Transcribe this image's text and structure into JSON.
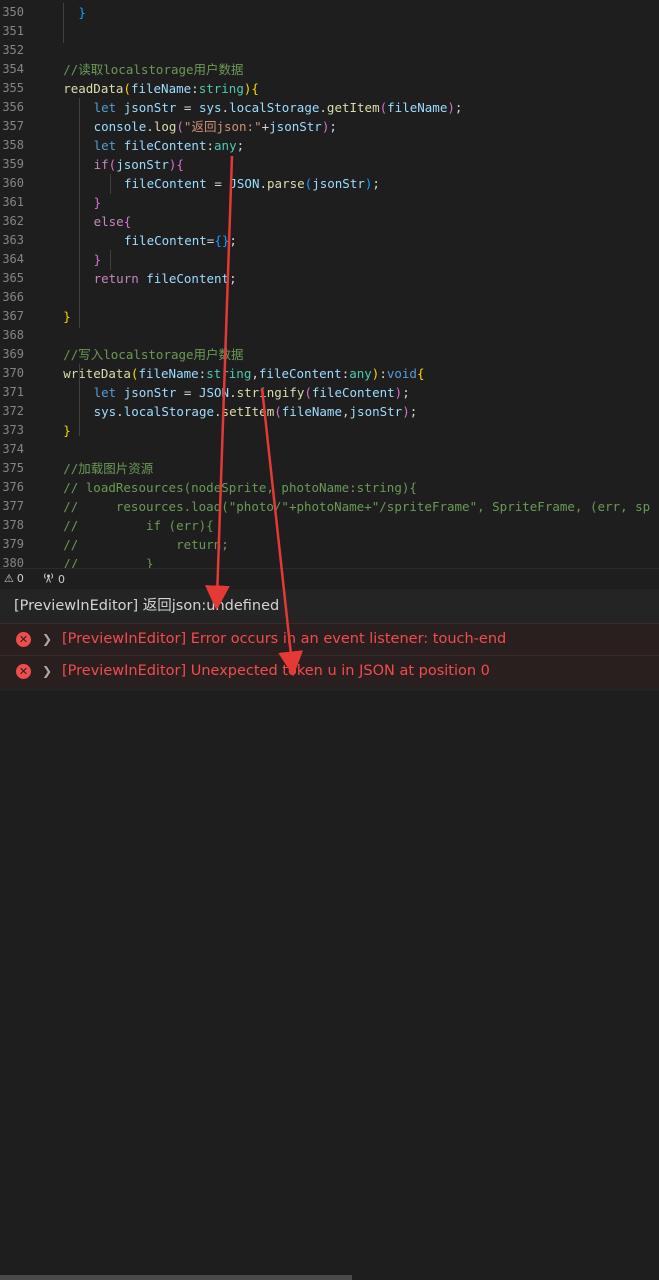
{
  "editor": {
    "lines": [
      {
        "n": "350",
        "indent": 4,
        "tokens": [
          [
            "}",
            "t-br2"
          ]
        ]
      },
      {
        "n": "351",
        "indent": 0,
        "tokens": []
      },
      {
        "n": "352",
        "indent": 0,
        "tokens": []
      },
      {
        "n": "354",
        "indent": 2,
        "tokens": [
          [
            "//读取localstorage用户数据",
            "t-cm"
          ]
        ]
      },
      {
        "n": "355",
        "indent": 2,
        "tokens": [
          [
            "readData",
            "t-fn"
          ],
          [
            "(",
            "t-br3"
          ],
          [
            "fileName",
            "t-var"
          ],
          [
            ":",
            "t-plain"
          ],
          [
            "string",
            "t-type"
          ],
          [
            ")",
            "t-br3"
          ],
          [
            "{",
            "t-br3"
          ]
        ]
      },
      {
        "n": "356",
        "indent": 6,
        "tokens": [
          [
            "let ",
            "t-kw"
          ],
          [
            "jsonStr",
            "t-var"
          ],
          [
            " = ",
            "t-plain"
          ],
          [
            "sys",
            "t-var"
          ],
          [
            ".",
            "t-plain"
          ],
          [
            "localStorage",
            "t-var"
          ],
          [
            ".",
            "t-plain"
          ],
          [
            "getItem",
            "t-fn"
          ],
          [
            "(",
            "t-br"
          ],
          [
            "fileName",
            "t-var"
          ],
          [
            ")",
            "t-br"
          ],
          [
            ";",
            "t-plain"
          ]
        ]
      },
      {
        "n": "357",
        "indent": 6,
        "tokens": [
          [
            "console",
            "t-var"
          ],
          [
            ".",
            "t-plain"
          ],
          [
            "log",
            "t-fn"
          ],
          [
            "(",
            "t-br"
          ],
          [
            "\"返回json:\"",
            "t-str"
          ],
          [
            "+",
            "t-plain"
          ],
          [
            "jsonStr",
            "t-var"
          ],
          [
            ")",
            "t-br"
          ],
          [
            ";",
            "t-plain"
          ]
        ]
      },
      {
        "n": "358",
        "indent": 6,
        "tokens": [
          [
            "let ",
            "t-kw"
          ],
          [
            "fileContent",
            "t-var"
          ],
          [
            ":",
            "t-plain"
          ],
          [
            "any",
            "t-type"
          ],
          [
            ";",
            "t-plain"
          ]
        ]
      },
      {
        "n": "359",
        "indent": 6,
        "tokens": [
          [
            "if",
            "t-ctrl"
          ],
          [
            "(",
            "t-br"
          ],
          [
            "jsonStr",
            "t-var"
          ],
          [
            ")",
            "t-br"
          ],
          [
            "{",
            "t-br"
          ]
        ]
      },
      {
        "n": "360",
        "indent": 10,
        "tokens": [
          [
            "fileContent",
            "t-var"
          ],
          [
            " = ",
            "t-plain"
          ],
          [
            "JSON",
            "t-var"
          ],
          [
            ".",
            "t-plain"
          ],
          [
            "parse",
            "t-fn"
          ],
          [
            "(",
            "t-br2"
          ],
          [
            "jsonStr",
            "t-var"
          ],
          [
            ")",
            "t-br2"
          ],
          [
            ";",
            "t-plain"
          ]
        ]
      },
      {
        "n": "361",
        "indent": 6,
        "tokens": [
          [
            "}",
            "t-br"
          ]
        ]
      },
      {
        "n": "362",
        "indent": 6,
        "tokens": [
          [
            "else",
            "t-ctrl"
          ],
          [
            "{",
            "t-br"
          ]
        ]
      },
      {
        "n": "363",
        "indent": 10,
        "tokens": [
          [
            "fileContent",
            "t-var"
          ],
          [
            "=",
            "t-plain"
          ],
          [
            "{}",
            "t-br2"
          ],
          [
            ";",
            "t-plain"
          ]
        ]
      },
      {
        "n": "364",
        "indent": 6,
        "tokens": [
          [
            "}",
            "t-br"
          ]
        ]
      },
      {
        "n": "365",
        "indent": 6,
        "tokens": [
          [
            "return ",
            "t-ctrl"
          ],
          [
            "fileContent",
            "t-var"
          ],
          [
            ";",
            "t-plain"
          ]
        ]
      },
      {
        "n": "366",
        "indent": 0,
        "tokens": []
      },
      {
        "n": "367",
        "indent": 2,
        "tokens": [
          [
            "}",
            "t-br3"
          ]
        ]
      },
      {
        "n": "368",
        "indent": 0,
        "tokens": []
      },
      {
        "n": "369",
        "indent": 2,
        "tokens": [
          [
            "//写入localstorage用户数据",
            "t-cm"
          ]
        ]
      },
      {
        "n": "370",
        "indent": 2,
        "tokens": [
          [
            "writeData",
            "t-fn"
          ],
          [
            "(",
            "t-br3"
          ],
          [
            "fileName",
            "t-var"
          ],
          [
            ":",
            "t-plain"
          ],
          [
            "string",
            "t-type"
          ],
          [
            ",",
            "t-plain"
          ],
          [
            "fileContent",
            "t-var"
          ],
          [
            ":",
            "t-plain"
          ],
          [
            "any",
            "t-type"
          ],
          [
            ")",
            "t-br3"
          ],
          [
            ":",
            "t-plain"
          ],
          [
            "void",
            "t-kw"
          ],
          [
            "{",
            "t-br3"
          ]
        ]
      },
      {
        "n": "371",
        "indent": 6,
        "tokens": [
          [
            "let ",
            "t-kw"
          ],
          [
            "jsonStr",
            "t-var"
          ],
          [
            " = ",
            "t-plain"
          ],
          [
            "JSON",
            "t-var"
          ],
          [
            ".",
            "t-plain"
          ],
          [
            "stringify",
            "t-fn"
          ],
          [
            "(",
            "t-br"
          ],
          [
            "fileContent",
            "t-var"
          ],
          [
            ")",
            "t-br"
          ],
          [
            ";",
            "t-plain"
          ]
        ]
      },
      {
        "n": "372",
        "indent": 6,
        "tokens": [
          [
            "sys",
            "t-var"
          ],
          [
            ".",
            "t-plain"
          ],
          [
            "localStorage",
            "t-var"
          ],
          [
            ".",
            "t-plain"
          ],
          [
            "setItem",
            "t-fn"
          ],
          [
            "(",
            "t-br"
          ],
          [
            "fileName",
            "t-var"
          ],
          [
            ",",
            "t-plain"
          ],
          [
            "jsonStr",
            "t-var"
          ],
          [
            ")",
            "t-br"
          ],
          [
            ";",
            "t-plain"
          ]
        ]
      },
      {
        "n": "373",
        "indent": 2,
        "tokens": [
          [
            "}",
            "t-br3"
          ]
        ]
      },
      {
        "n": "374",
        "indent": 0,
        "tokens": []
      },
      {
        "n": "375",
        "indent": 2,
        "tokens": [
          [
            "//加载图片资源",
            "t-cm"
          ]
        ]
      },
      {
        "n": "376",
        "indent": 2,
        "tokens": [
          [
            "// loadResources(nodeSprite, photoName:string){",
            "t-cm"
          ]
        ]
      },
      {
        "n": "377",
        "indent": 2,
        "tokens": [
          [
            "//     resources.load(\"photo/\"+photoName+\"/spriteFrame\", SpriteFrame, (err, sp",
            "t-cm"
          ]
        ]
      },
      {
        "n": "378",
        "indent": 2,
        "tokens": [
          [
            "//         if (err){",
            "t-cm"
          ]
        ]
      },
      {
        "n": "379",
        "indent": 2,
        "tokens": [
          [
            "//             return;",
            "t-cm"
          ]
        ]
      },
      {
        "n": "380",
        "indent": 2,
        "tokens": [
          [
            "//         }",
            "t-cm"
          ]
        ]
      }
    ]
  },
  "status": {
    "errors": "0",
    "ports": "0"
  },
  "console": {
    "info": "[PreviewInEditor] 返回json:undefined",
    "errors": [
      "[PreviewInEditor] Error occurs in an event listener: touch-end",
      "[PreviewInEditor] Unexpected token u in JSON at position 0"
    ]
  },
  "colors": {
    "annotation_arrow": "#e53935",
    "error_text": "#f14c4c"
  }
}
